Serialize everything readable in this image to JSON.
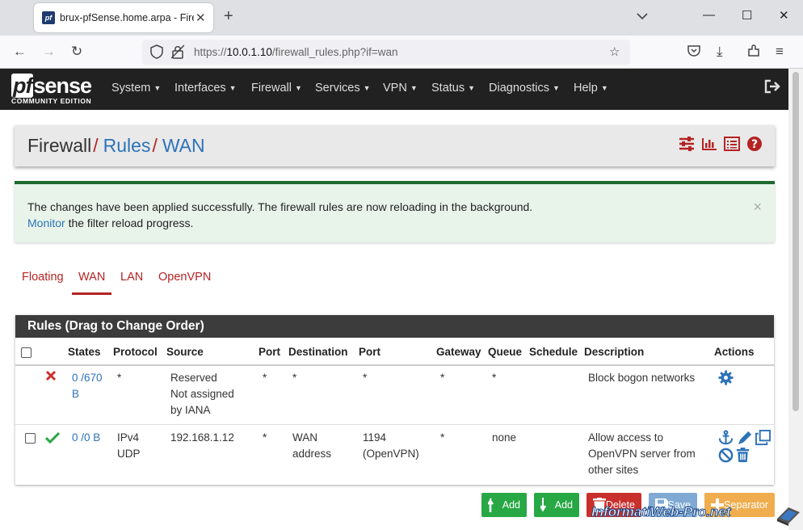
{
  "browser": {
    "tab_title": "brux-pfSense.home.arpa - Firew",
    "url_prefix": "https://",
    "url_host": "10.0.1.10",
    "url_path": "/firewall_rules.php?if=wan"
  },
  "header": {
    "logo_main": "sense",
    "logo_pf": "pf",
    "logo_sub": "COMMUNITY EDITION",
    "menu": [
      "System",
      "Interfaces",
      "Firewall",
      "Services",
      "VPN",
      "Status",
      "Diagnostics",
      "Help"
    ]
  },
  "breadcrumb": {
    "part1": "Firewall",
    "part2": "Rules",
    "part3": "WAN",
    "sep": "/"
  },
  "alert": {
    "line1": "The changes have been applied successfully. The firewall rules are now reloading in the background.",
    "link": "Monitor",
    "line2": " the filter reload progress.",
    "close": "×"
  },
  "tabs": [
    "Floating",
    "WAN",
    "LAN",
    "OpenVPN"
  ],
  "active_tab": "WAN",
  "rules": {
    "title": "Rules (Drag to Change Order)",
    "columns": [
      "States",
      "Protocol",
      "Source",
      "Port",
      "Destination",
      "Port",
      "Gateway",
      "Queue",
      "Schedule",
      "Description",
      "Actions"
    ],
    "rows": [
      {
        "states_l1": "0 /670",
        "states_l2": "B",
        "protocol_l1": "*",
        "protocol_l2": "",
        "source_l1": "Reserved",
        "source_l2": "Not assigned",
        "source_l3": "by IANA",
        "sport": "*",
        "dest_l1": "*",
        "dest_l2": "",
        "dport_l1": "*",
        "dport_l2": "",
        "gateway": "*",
        "queue": "*",
        "schedule": "",
        "desc_l1": "Block bogon networks",
        "desc_l2": "",
        "desc_l3": ""
      },
      {
        "states_l1": "0 /0 B",
        "states_l2": "",
        "protocol_l1": "IPv4",
        "protocol_l2": "UDP",
        "source_l1": "192.168.1.12",
        "source_l2": "",
        "source_l3": "",
        "sport": "*",
        "dest_l1": "WAN",
        "dest_l2": "address",
        "dport_l1": "1194",
        "dport_l2": "(OpenVPN)",
        "gateway": "*",
        "queue": "none",
        "schedule": "",
        "desc_l1": "Allow access to",
        "desc_l2": "OpenVPN server from",
        "desc_l3": "other sites"
      }
    ]
  },
  "buttons": {
    "add_top": "Add",
    "add_bottom": "Add",
    "delete": "Delete",
    "save": "Save",
    "separator": "Separator"
  },
  "watermark": "InformatiWeb-Pro.net",
  "colors": {
    "accent_red": "#b52323",
    "link_blue": "#2d73b8",
    "success_green": "#1f6a2f",
    "btn_green": "#27a844"
  }
}
